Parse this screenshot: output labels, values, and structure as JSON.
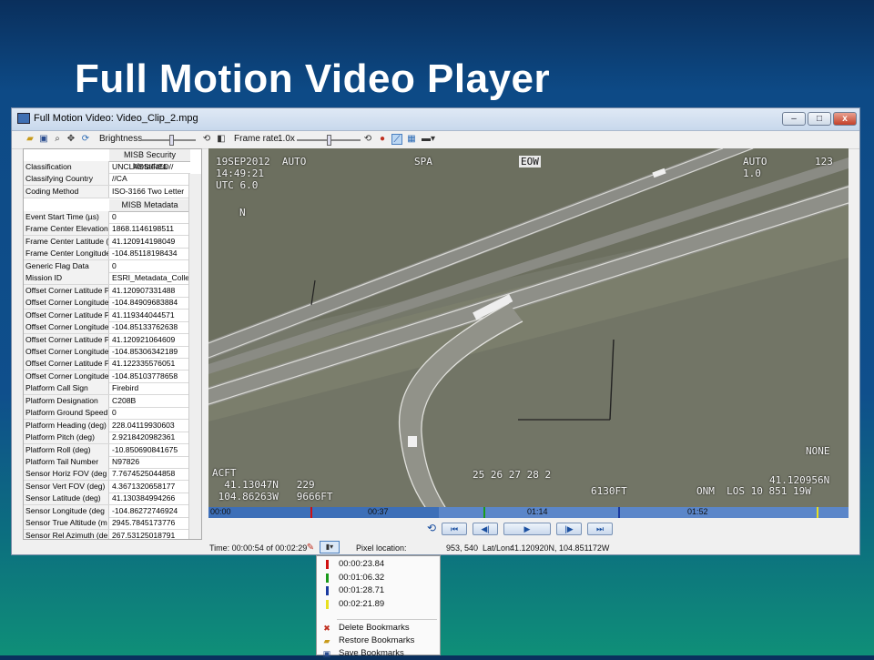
{
  "slide": {
    "title": "Full Motion Video Player"
  },
  "window": {
    "title": "Full Motion Video:  Video_Clip_2.mpg",
    "buttons": {
      "minimize": "–",
      "maximize": "□",
      "close": "x"
    }
  },
  "toolbar": {
    "brightness_label": "Brightness",
    "framerate_label": "Frame rate",
    "framerate_value": "1.0x",
    "brightness_level": 0.55,
    "framerate_level": 0.5
  },
  "metadata": {
    "security_header": "MISB Security Metadata",
    "security_rows": [
      {
        "k": "Classification",
        "v": "UNCLASSIFIED//"
      },
      {
        "k": "Classifying Country",
        "v": "//CA"
      },
      {
        "k": "Coding Method",
        "v": "ISO-3166 Two Letter"
      }
    ],
    "misb_header": "MISB Metadata",
    "rows": [
      {
        "k": "Event Start Time (µs)",
        "v": "0"
      },
      {
        "k": "Frame Center Elevation",
        "v": "1868.1146198511"
      },
      {
        "k": "Frame Center Latitude (",
        "v": "41.120914198049"
      },
      {
        "k": "Frame Center Longitude",
        "v": "-104.85118198434"
      },
      {
        "k": "Generic Flag Data",
        "v": "0"
      },
      {
        "k": "Mission ID",
        "v": "ESRI_Metadata_Colle"
      },
      {
        "k": "Offset Corner Latitude P",
        "v": "41.120907331488"
      },
      {
        "k": "Offset Corner Longitude",
        "v": "-104.84909683884"
      },
      {
        "k": "Offset Corner Latitude P",
        "v": "41.119344044571"
      },
      {
        "k": "Offset Corner Longitude",
        "v": "-104.85133762638"
      },
      {
        "k": "Offset Corner Latitude P",
        "v": "41.120921064609"
      },
      {
        "k": "Offset Corner Longitude",
        "v": "-104.85306342189"
      },
      {
        "k": "Offset Corner Latitude P",
        "v": "41.122335576051"
      },
      {
        "k": "Offset Corner Longitude",
        "v": "-104.85103778658"
      },
      {
        "k": "Platform Call Sign",
        "v": "Firebird"
      },
      {
        "k": "Platform Designation",
        "v": "C208B"
      },
      {
        "k": "Platform Ground Speed",
        "v": "0"
      },
      {
        "k": "Platform Heading (deg)",
        "v": "228.04119930603"
      },
      {
        "k": "Platform Pitch (deg)",
        "v": "2.9218420982361"
      },
      {
        "k": "Platform Roll (deg)",
        "v": "-10.850690841675"
      },
      {
        "k": "Platform Tail Number",
        "v": "N97826"
      },
      {
        "k": "Sensor Horiz FOV (deg",
        "v": "7.7674525044858"
      },
      {
        "k": "Sensor Vert FOV (deg)",
        "v": "4.3671320658177"
      },
      {
        "k": "Sensor Latitude (deg)",
        "v": "41.130384994266"
      },
      {
        "k": "Sensor Longitude (deg",
        "v": "-104.86272746924"
      },
      {
        "k": "Sensor True Altitude (m",
        "v": "2945.7845173776"
      },
      {
        "k": "Sensor Rel Azimuth (de",
        "v": "267.53125018791"
      }
    ]
  },
  "osd": {
    "top_left": "19SEP2012  AUTO\n14:49:21\nUTC 6.0",
    "spa": "SPA",
    "eow": "EOW",
    "top_right_num": "123",
    "top_right_mid": "AUTO\n1.0",
    "north": "N",
    "bottom_left": "ACFT\n  41.13047N   229\n 104.86263W   9666FT",
    "bottom_mid": "25 26 27 28 2",
    "bottom_mid2": "6130FT",
    "bottom_right": "ONM  LOS 10 851 19W",
    "bottom_right2": "NONE",
    "bottom_right3": "41.120956N"
  },
  "timeline": {
    "labels": [
      "00:00",
      "00:37",
      "01:14",
      "01:52"
    ],
    "markers": [
      {
        "pos": 0.16,
        "color": "#d01010"
      },
      {
        "pos": 0.43,
        "color": "#1a9a1a"
      },
      {
        "pos": 0.64,
        "color": "#1a3aa0"
      },
      {
        "pos": 0.95,
        "color": "#e8e020"
      }
    ],
    "played_fraction": 0.36
  },
  "controls": {
    "loop": "⟲",
    "first": "⏮",
    "step_back": "◀|",
    "play": "▶",
    "step_fwd": "|▶",
    "last": "⏭"
  },
  "status": {
    "time": "Time: 00:00:54  of  00:02:29",
    "pixel_label": "Pixel location:",
    "pixel_value": "953, 540",
    "latlon_label": "Lat/Lon:",
    "latlon_value": "41.120920N, 104.851172W"
  },
  "bookmarks": {
    "items": [
      {
        "time": "00:00:23.84",
        "color": "#d01010"
      },
      {
        "time": "00:01:06.32",
        "color": "#1a9a1a"
      },
      {
        "time": "00:01:28.71",
        "color": "#1a3aa0"
      },
      {
        "time": "00:02:21.89",
        "color": "#e8e020"
      }
    ],
    "delete": "Delete Bookmarks",
    "restore": "Restore Bookmarks",
    "save": "Save Bookmarks"
  }
}
